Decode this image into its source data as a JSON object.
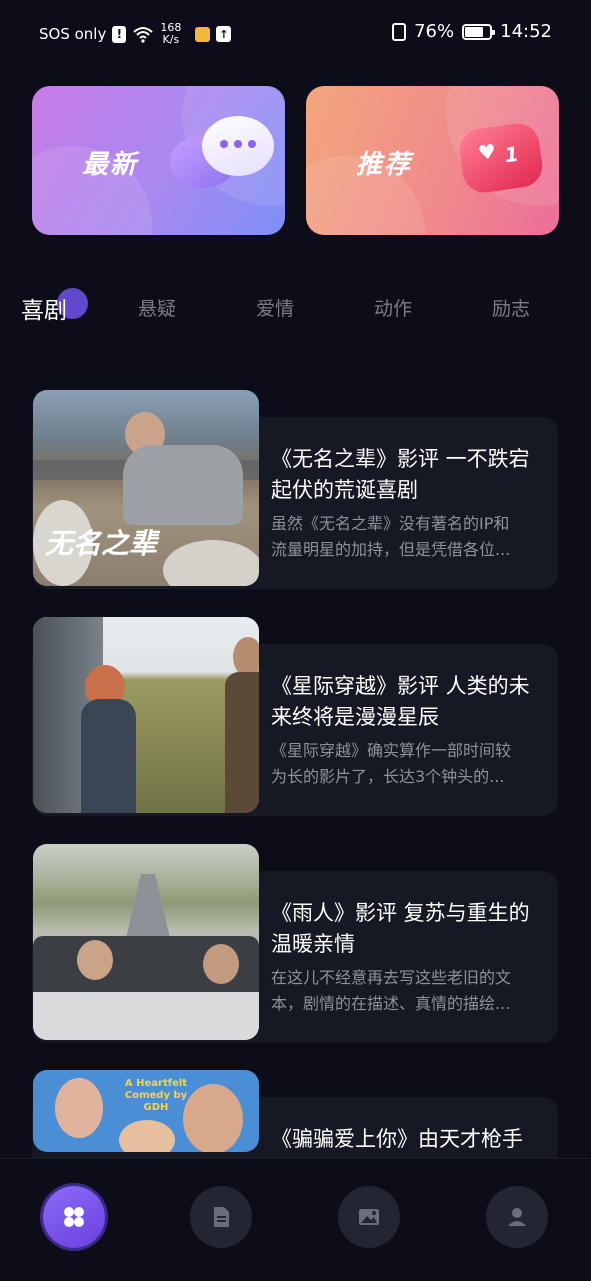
{
  "status_bar": {
    "carrier": "SOS only",
    "net_speed_value": "168",
    "net_speed_unit": "K/s",
    "battery": "76%",
    "time": "14:52"
  },
  "top_cards": [
    {
      "label": "最新",
      "icon": "chat-bubbles-icon"
    },
    {
      "label": "推荐",
      "icon": "heart-bubble-icon",
      "badge": "1"
    }
  ],
  "tabs": [
    "喜剧",
    "悬疑",
    "爱情",
    "动作",
    "励志"
  ],
  "active_tab": "喜剧",
  "articles": [
    {
      "title": "《无名之辈》影评 一不跌宕起伏的荒诞喜剧",
      "desc_line1": "虽然《无名之辈》没有著名的IP和",
      "desc_line2": "流量明星的加持，但是凭借各位...",
      "poster_text": "无名之辈"
    },
    {
      "title": "《星际穿越》影评 人类的未来终将是漫漫星辰",
      "desc_line1": "《星际穿越》确实算作一部时间较",
      "desc_line2": "为长的影片了，长达3个钟头的...",
      "poster_text": ""
    },
    {
      "title": "《雨人》影评 复苏与重生的温暖亲情",
      "desc_line1": "在这儿不经意再去写这些老旧的文",
      "desc_line2": "本，剧情的在描述、真情的描绘...",
      "poster_text": ""
    },
    {
      "title": "《骗骗爱上你》由天才枪手",
      "desc_line1": "",
      "desc_line2": "",
      "poster_text": "A Heartfelt Comedy by GDH"
    }
  ],
  "bottom_nav": [
    {
      "icon": "grid-icon",
      "active": true
    },
    {
      "icon": "document-icon",
      "active": false
    },
    {
      "icon": "image-icon",
      "active": false
    },
    {
      "icon": "profile-icon",
      "active": false
    }
  ],
  "colors": {
    "background": "#0c0d18",
    "card_panel": "#161824",
    "accent": "#7b5cf0"
  }
}
